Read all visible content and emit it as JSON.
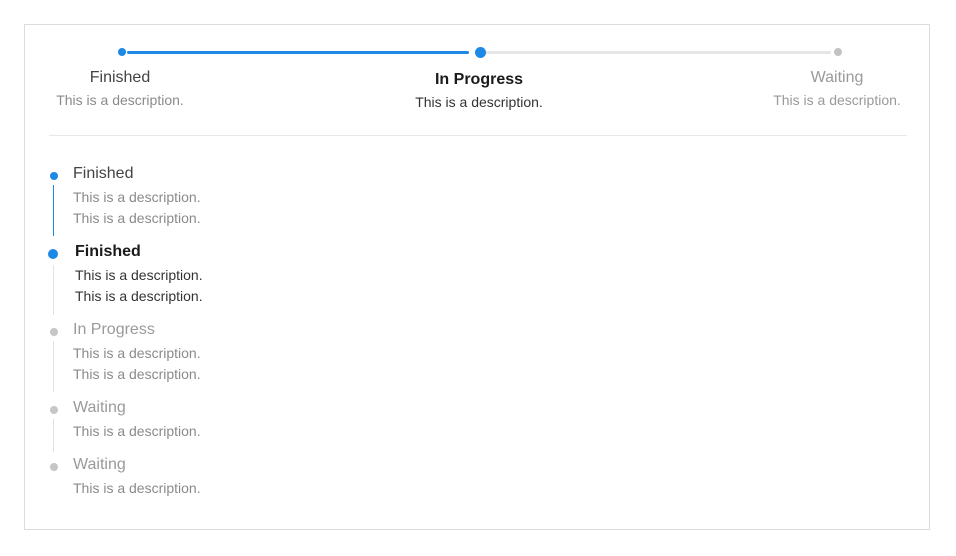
{
  "colors": {
    "accent": "#1e88e5",
    "inactive_dot": "#c2c2c2",
    "inactive_line": "#e6e6e6",
    "border": "#dcdcdc"
  },
  "horizontal_steps": [
    {
      "title": "Finished",
      "description": "This is a description.",
      "status": "finished"
    },
    {
      "title": "In Progress",
      "description": "This is a description.",
      "status": "current"
    },
    {
      "title": "Waiting",
      "description": "This is a description.",
      "status": "waiting"
    }
  ],
  "vertical_steps": [
    {
      "title": "Finished",
      "descriptions": [
        "This is a description.",
        "This is a description."
      ],
      "status": "finished"
    },
    {
      "title": "Finished",
      "descriptions": [
        "This is a description.",
        "This is a description."
      ],
      "status": "current"
    },
    {
      "title": "In Progress",
      "descriptions": [
        "This is a description.",
        "This is a description."
      ],
      "status": "waiting"
    },
    {
      "title": "Waiting",
      "descriptions": [
        "This is a description."
      ],
      "status": "waiting"
    },
    {
      "title": "Waiting",
      "descriptions": [
        "This is a description."
      ],
      "status": "waiting"
    }
  ]
}
